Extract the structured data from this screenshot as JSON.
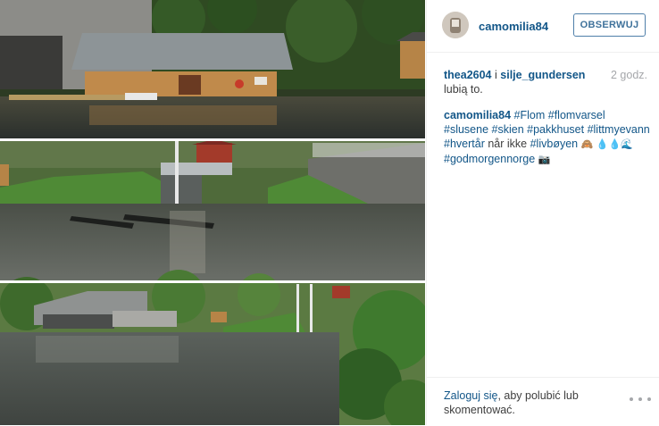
{
  "post": {
    "photo": {
      "description_icon": "collage-photo",
      "panels": 3
    }
  },
  "header": {
    "username": "camomilia84",
    "follow_label": "OBSERWUJ"
  },
  "likes": {
    "user1": "thea2604",
    "conjunction": "i",
    "user2": "silje_gundersen",
    "suffix": "lubią to.",
    "time": "2 godz."
  },
  "caption": {
    "author": "camomilia84",
    "tag_flom": "#Flom",
    "tag_flomvarsel": "#flomvarsel",
    "tag_slusene": "#slusene",
    "tag_skien": "#skien",
    "tag_pakkhuset": "#pakkhuset",
    "tag_littmyevann": "#littmyevann",
    "tag_hvertar": "#hvertår",
    "plain_text": "når ikke",
    "tag_livboyen": "#livbøyen",
    "emoji1": "🙈",
    "emoji2": "💧💧🌊",
    "tag_godmorgen": "#godmorgennorge",
    "emoji3": "📷"
  },
  "footer": {
    "login_link": "Zaloguj się",
    "login_rest": ", aby polubić lub skomentować."
  },
  "colors": {
    "link": "#125688",
    "follow_border": "#4f7fa9",
    "text": "#3d3d3d",
    "muted": "#a5a7aa"
  }
}
